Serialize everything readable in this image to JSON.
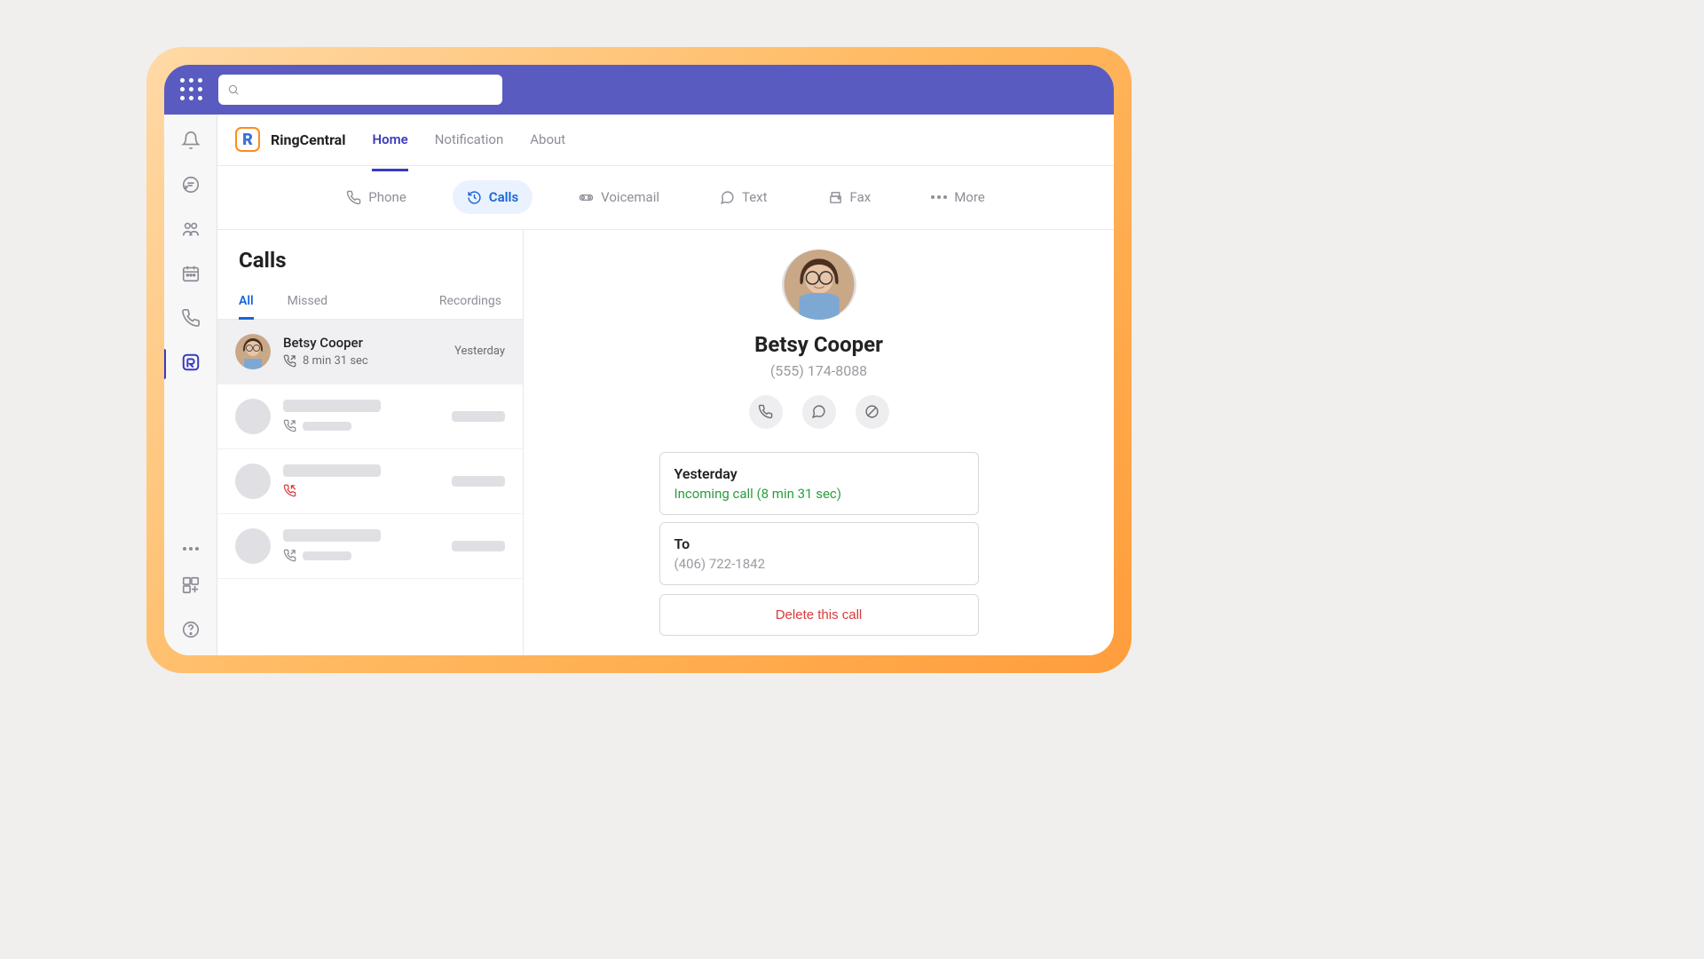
{
  "search": {
    "placeholder": ""
  },
  "brand": {
    "name": "RingCentral"
  },
  "brand_tabs": {
    "home": "Home",
    "notification": "Notification",
    "about": "About"
  },
  "subnav": {
    "phone": "Phone",
    "calls": "Calls",
    "voicemail": "Voicemail",
    "text": "Text",
    "fax": "Fax",
    "more": "More"
  },
  "calls_panel": {
    "title": "Calls",
    "tabs": {
      "all": "All",
      "missed": "Missed",
      "recordings": "Recordings"
    }
  },
  "call_items": [
    {
      "name": "Betsy Cooper",
      "duration": "8 min 31 sec",
      "when": "Yesterday"
    }
  ],
  "detail": {
    "name": "Betsy Cooper",
    "phone": "(555) 174-8088",
    "card1_title": "Yesterday",
    "card1_sub": "Incoming call (8 min 31 sec)",
    "card2_title": "To",
    "card2_sub": "(406) 722-1842",
    "delete_label": "Delete this call"
  }
}
